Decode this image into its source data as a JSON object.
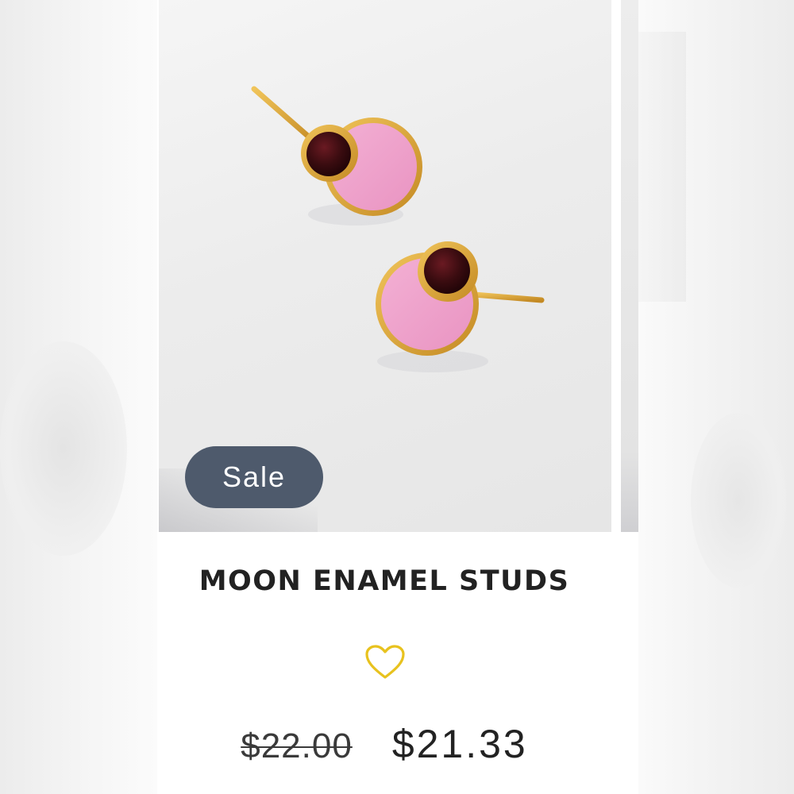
{
  "product": {
    "badge": "Sale",
    "title": "MOON ENAMEL STUDS",
    "price_original": "$22.00",
    "price_sale": "$21.33",
    "wishlist_icon": "heart-outline-icon"
  },
  "colors": {
    "badge_bg": "#4e5a6c",
    "heart": "#e8c21e",
    "enamel": "#ee9fc9",
    "stone": "#3a0c10",
    "gold": "#d9a33a"
  }
}
